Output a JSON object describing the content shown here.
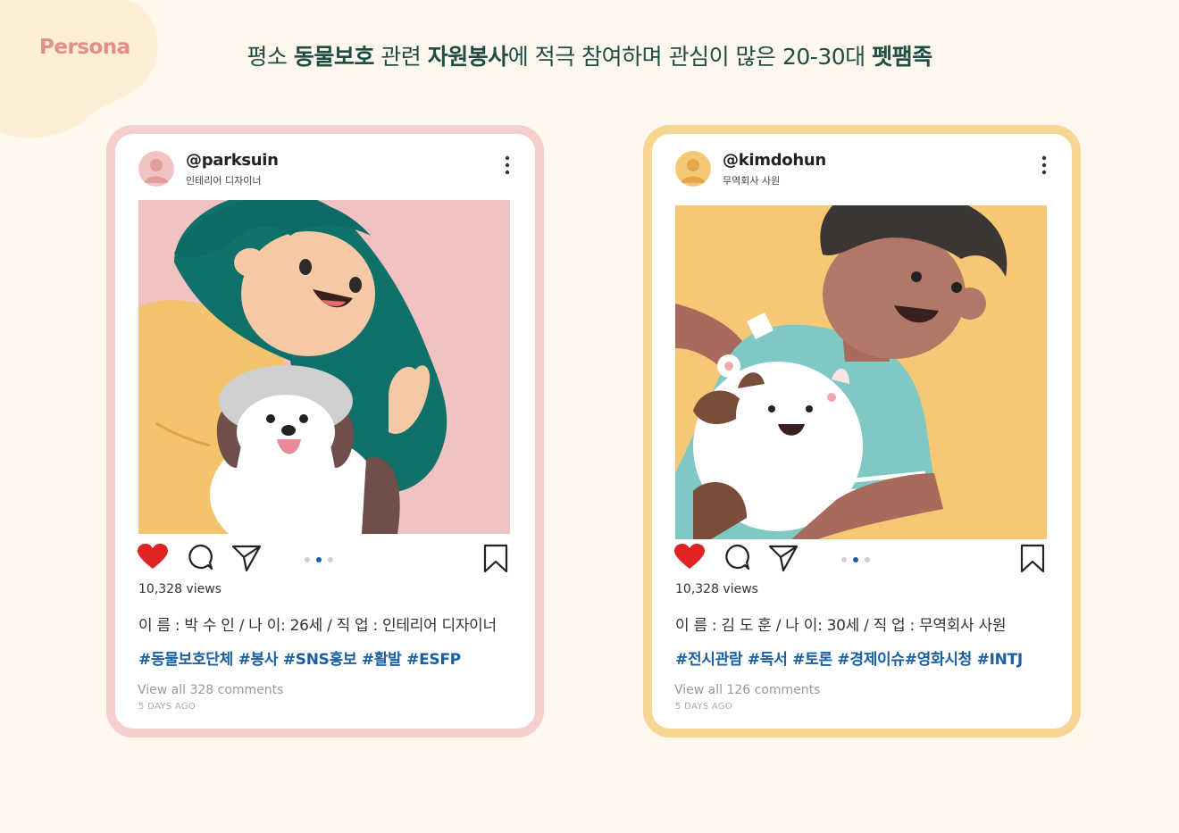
{
  "badge": "Persona",
  "headline": {
    "p1": "평소 ",
    "b1": "동물보호",
    "p2": " 관련 ",
    "b2": "자원봉사",
    "p3": "에 적극 참여하며 관심이 많은 20-30대 ",
    "b3": "펫팸족"
  },
  "colors": {
    "background": "#fdf7ee",
    "badge": "#e38f88",
    "headline": "#1f4d42",
    "pink_frame": "#f5cfcc",
    "yellow_frame": "#f7d694",
    "hashtag": "#1b5fa3",
    "heart": "#e02424"
  },
  "cards": [
    {
      "handle": "@parksuin",
      "job": "인테리어 디자이너",
      "views": "10,328 views",
      "profile": "이 름 : 박 수 인 / 나 이: 26세 / 직 업 : 인테리어 디자이너",
      "tags": "#동물보호단체 #봉사 #SNS홍보 #활발 #ESFP",
      "comments": "View all 328 comments",
      "ago": "5 DAYS AGO",
      "carousel": {
        "count": 3,
        "active": 2
      }
    },
    {
      "handle": "@kimdohun",
      "job": "무역회사 사원",
      "views": "10,328 views",
      "profile": "이 름 : 김 도 훈 / 나 이: 30세 / 직 업 : 무역회사 사원",
      "tags": "#전시관람 #독서 #토론 #경제이슈#영화시청 #INTJ",
      "comments": "View all 126 comments",
      "ago": "5 DAYS AGO",
      "carousel": {
        "count": 3,
        "active": 2
      }
    }
  ]
}
